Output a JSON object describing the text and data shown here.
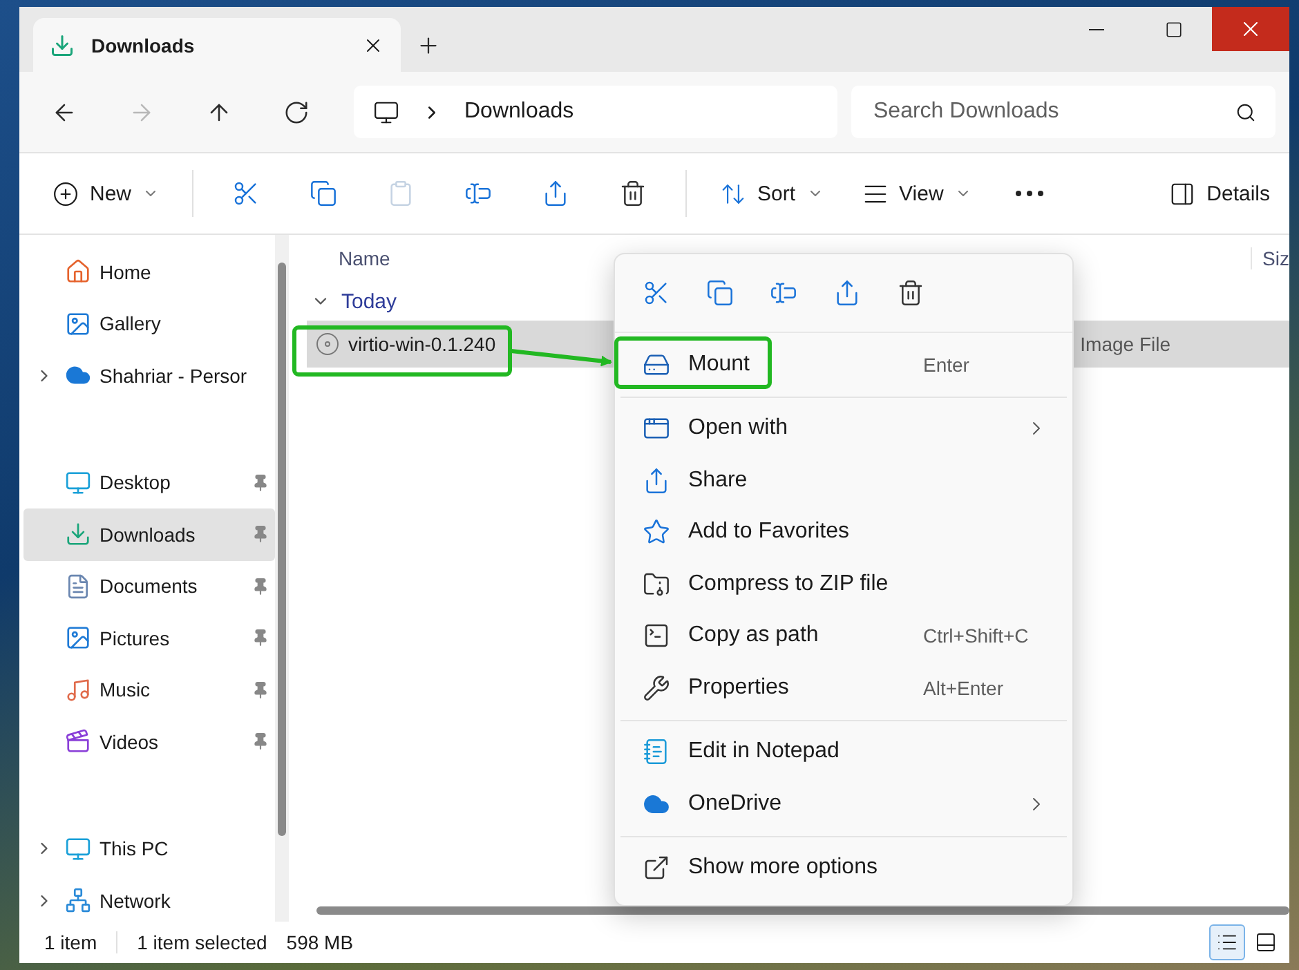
{
  "window": {
    "tab_title": "Downloads"
  },
  "nav_buttons": [
    {
      "kind": "back",
      "disabled": false
    },
    {
      "kind": "forward",
      "disabled": true
    },
    {
      "kind": "up",
      "disabled": false
    },
    {
      "kind": "refresh",
      "disabled": false
    }
  ],
  "address": {
    "path": "Downloads"
  },
  "search": {
    "placeholder": "Search Downloads"
  },
  "toolbar": {
    "new": "New",
    "actions": [
      {
        "kind": "cut",
        "disabled": false
      },
      {
        "kind": "copy",
        "disabled": false
      },
      {
        "kind": "paste",
        "disabled": true
      },
      {
        "kind": "rename",
        "disabled": false
      },
      {
        "kind": "share",
        "disabled": false
      },
      {
        "kind": "delete",
        "disabled": false
      }
    ],
    "sort": "Sort",
    "view": "View",
    "details": "Details"
  },
  "sidebar": {
    "sections": [
      {
        "items": [
          {
            "label": "Home",
            "kind": "home",
            "selected": false,
            "pinned": false,
            "expandable": false
          },
          {
            "label": "Gallery",
            "kind": "gallery",
            "selected": false,
            "pinned": false,
            "expandable": false
          },
          {
            "label": "Shahriar - Persor",
            "kind": "cloud",
            "selected": false,
            "pinned": false,
            "expandable": true
          }
        ]
      },
      {
        "items": [
          {
            "label": "Desktop",
            "kind": "desktop",
            "selected": false,
            "pinned": true,
            "expandable": false
          },
          {
            "label": "Downloads",
            "kind": "downloads",
            "selected": true,
            "pinned": true,
            "expandable": false
          },
          {
            "label": "Documents",
            "kind": "documents",
            "selected": false,
            "pinned": true,
            "expandable": false
          },
          {
            "label": "Pictures",
            "kind": "pictures",
            "selected": false,
            "pinned": true,
            "expandable": false
          },
          {
            "label": "Music",
            "kind": "music",
            "selected": false,
            "pinned": true,
            "expandable": false
          },
          {
            "label": "Videos",
            "kind": "videos",
            "selected": false,
            "pinned": true,
            "expandable": false
          }
        ]
      },
      {
        "items": [
          {
            "label": "This PC",
            "kind": "pc",
            "selected": false,
            "pinned": false,
            "expandable": true
          },
          {
            "label": "Network",
            "kind": "network",
            "selected": false,
            "pinned": false,
            "expandable": true
          }
        ]
      }
    ]
  },
  "file_list": {
    "columns": [
      "Name",
      "Siz"
    ],
    "groups": [
      {
        "label": "Today",
        "expanded": true,
        "rows": [
          {
            "name": "virtio-win-0.1.240",
            "type": "Image File",
            "selected": true
          }
        ]
      }
    ]
  },
  "context_menu": {
    "quick_actions": [
      {
        "kind": "cut"
      },
      {
        "kind": "copy"
      },
      {
        "kind": "rename"
      },
      {
        "kind": "share"
      },
      {
        "kind": "delete"
      }
    ],
    "sections": [
      {
        "items": [
          {
            "label": "Mount",
            "shortcut": "Enter",
            "kind": "mount",
            "submenu": false
          }
        ]
      },
      {
        "items": [
          {
            "label": "Open with",
            "kind": "open_with",
            "submenu": true
          },
          {
            "label": "Share",
            "kind": "share",
            "submenu": false
          },
          {
            "label": "Add to Favorites",
            "kind": "star",
            "submenu": false
          },
          {
            "label": "Compress to ZIP file",
            "kind": "zip",
            "submenu": false
          },
          {
            "label": "Copy as path",
            "shortcut": "Ctrl+Shift+C",
            "kind": "path",
            "submenu": false
          },
          {
            "label": "Properties",
            "shortcut": "Alt+Enter",
            "kind": "properties",
            "submenu": false
          }
        ]
      },
      {
        "items": [
          {
            "label": "Edit in Notepad",
            "kind": "notepad",
            "submenu": false
          },
          {
            "label": "OneDrive",
            "kind": "onedrive",
            "submenu": true
          }
        ]
      },
      {
        "items": [
          {
            "label": "Show more options",
            "kind": "more",
            "submenu": false
          }
        ]
      }
    ]
  },
  "status_bar": {
    "count": "1 item",
    "selection": "1 item selected",
    "size": "598 MB",
    "view_buttons": [
      {
        "kind": "details",
        "selected": true
      },
      {
        "kind": "tiles",
        "selected": false
      }
    ]
  }
}
